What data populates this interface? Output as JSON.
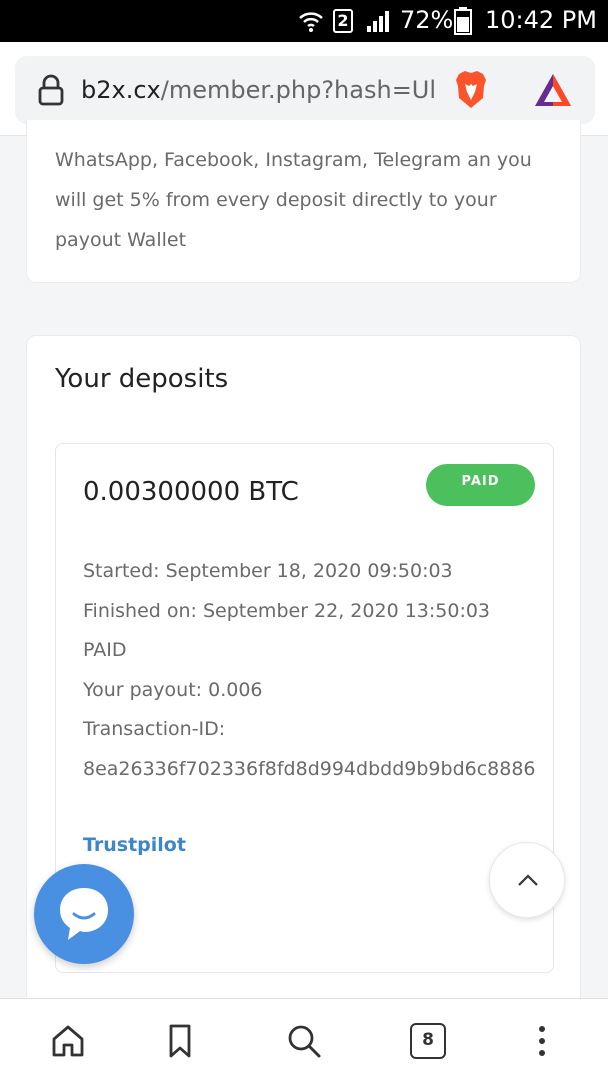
{
  "status_bar": {
    "sim_number": "2",
    "battery_percent": "72%",
    "time": "10:42 PM"
  },
  "browser": {
    "url_domain": "b2x.cx",
    "url_path": "/member.php?hash=Ul",
    "tab_count": "8"
  },
  "referral": {
    "text": "WhatsApp, Facebook, Instagram, Telegram an you will get 5% from every deposit directly to your payout Wallet"
  },
  "deposits": {
    "title": "Your deposits",
    "item": {
      "amount": "0.00300000 BTC",
      "status_badge": "PAID",
      "started": "Started: September 18, 2020 09:50:03",
      "finished": "Finished on: September 22, 2020 13:50:03",
      "status_text": "PAID",
      "payout": "Your payout: 0.006",
      "txid_label": "Transaction-ID:",
      "txid_value": "8ea26336f702336f8fd8d994dbdd9b9bd6c8886"
    },
    "trustpilot_link": "Trustpilot"
  },
  "colors": {
    "paid_badge": "#4cc05c",
    "link": "#3d87c9",
    "chat_button": "#4a90e2"
  },
  "icons": {
    "status": [
      "wifi-icon",
      "signal-icon",
      "battery-icon"
    ],
    "url_bar": [
      "lock-icon",
      "brave-shields-icon",
      "brave-rewards-icon"
    ],
    "floating": [
      "scroll-to-top-icon",
      "chat-icon"
    ],
    "bottom_nav": [
      "home-icon",
      "bookmark-icon",
      "search-icon",
      "tabs-icon",
      "menu-icon"
    ]
  }
}
